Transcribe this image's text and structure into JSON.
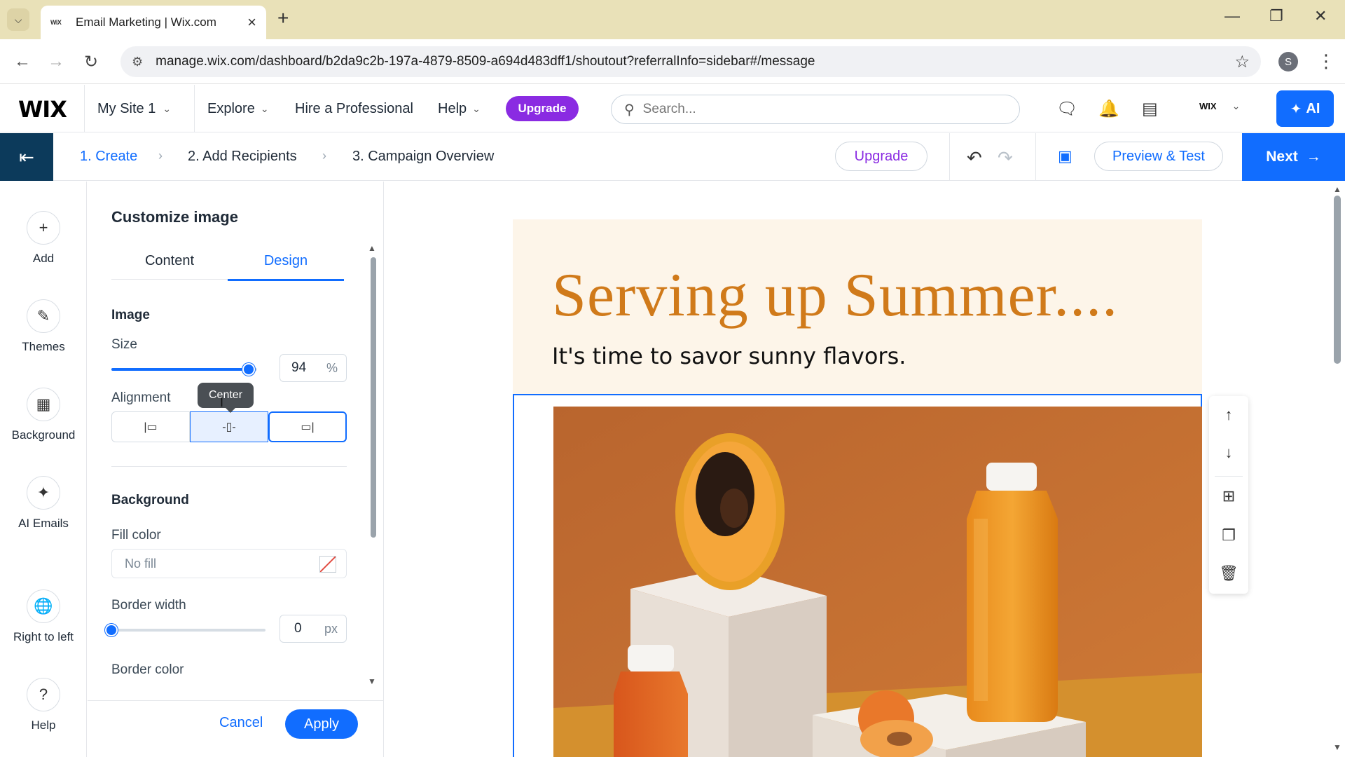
{
  "browser": {
    "tab_title": "Email Marketing | Wix.com",
    "favicon": "WiX",
    "url": "manage.wix.com/dashboard/b2da9c2b-197a-4879-8509-a694d483dff1/shoutout?referralInfo=sidebar#/message",
    "profile_initial": "S"
  },
  "wixbar": {
    "logo": "WIX",
    "site_name": "My Site 1",
    "menu": [
      "Explore",
      "Hire a Professional",
      "Help"
    ],
    "upgrade": "Upgrade",
    "search_placeholder": "Search...",
    "account_label": "WIX",
    "ai_label": "AI"
  },
  "steps": {
    "items": [
      "1. Create",
      "2. Add Recipients",
      "3. Campaign Overview"
    ],
    "upgrade": "Upgrade",
    "preview": "Preview & Test",
    "next": "Next"
  },
  "rail": {
    "items": [
      "Add",
      "Themes",
      "Background",
      "AI Emails",
      "Right to left",
      "Help"
    ]
  },
  "panel": {
    "title": "Customize image",
    "tabs": [
      "Content",
      "Design"
    ],
    "active_tab": "Design",
    "image_section": "Image",
    "size_label": "Size",
    "size_value": "94",
    "size_unit": "%",
    "size_fraction": 0.94,
    "alignment_label": "Alignment",
    "alignment_tooltip": "Center",
    "alignment_options": [
      "left",
      "center",
      "right"
    ],
    "alignment_selected": "right",
    "background_section": "Background",
    "fill_label": "Fill color",
    "fill_value": "No fill",
    "border_width_label": "Border width",
    "border_width_value": "0",
    "border_width_unit": "px",
    "border_color_label": "Border color",
    "cancel": "Cancel",
    "apply": "Apply"
  },
  "email": {
    "headline": "Serving up Summer....",
    "subhead": "It's time to savor sunny flavors."
  },
  "colors": {
    "accent": "#116dff",
    "upgrade_purple": "#8a2be2",
    "headline_orange": "#d07a1a",
    "header_bg": "#fdf5e9",
    "exit_navy": "#0c3a5b"
  }
}
